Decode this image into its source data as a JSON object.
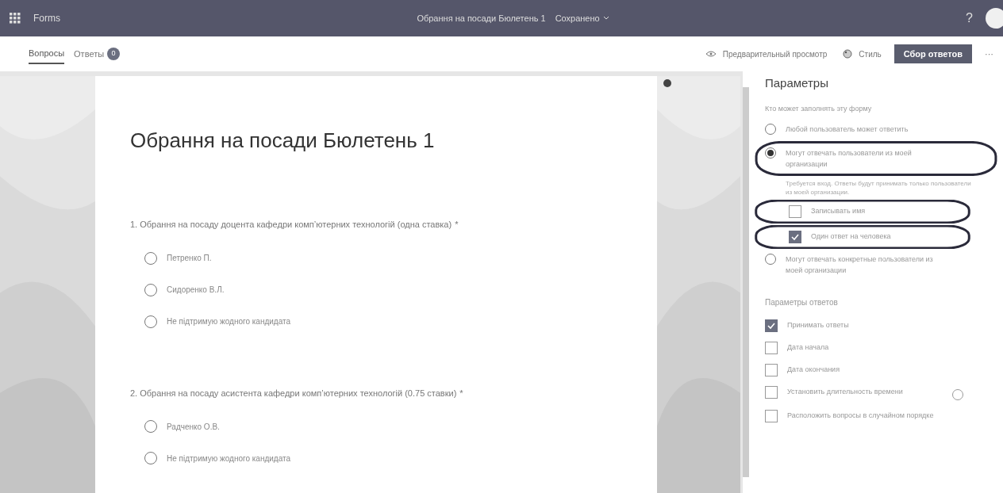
{
  "header": {
    "app": "Forms",
    "title": "Обрання на посади Бюлетень 1",
    "status": "Сохранено",
    "help": "?"
  },
  "tabs": [
    {
      "label": "Вопросы",
      "selected": true
    },
    {
      "label": "Ответы",
      "selected": false,
      "badge": "0"
    }
  ],
  "toolbar": {
    "preview": "Предварительный просмотр",
    "style": "Стиль",
    "collect": "Сбор ответов",
    "more": "···"
  },
  "form": {
    "title": "Обрання на посади Бюлетень 1",
    "questions": [
      {
        "text": "1. Обрання на посаду доцента кафедри комп’ютерних технологій (одна ставка)",
        "required_mark": "*",
        "options": [
          {
            "label": "Петренко П.",
            "selected": false
          },
          {
            "label": "Сидоренко В.Л.",
            "selected": false
          },
          {
            "label": "Не підтримую жодного кандидата",
            "selected": false
          }
        ]
      },
      {
        "text": "2. Обрання на посаду асистента кафедри комп’ютерних технологій (0.75 ставки)",
        "required_mark": "*",
        "options": [
          {
            "label": "Радченко О.В.",
            "selected": false
          },
          {
            "label": "Не підтримую жодного кандидата",
            "selected": false
          }
        ]
      }
    ]
  },
  "settings": {
    "title": "Параметры",
    "who_label": "Кто может заполнять эту форму",
    "who": [
      {
        "kind": "radio",
        "label": "Любой пользователь может ответить",
        "selected": false
      },
      {
        "kind": "radio",
        "label": "Могут отвечать пользователи из моей организации",
        "selected": true,
        "circled": true
      },
      {
        "kind": "note",
        "label": "Требуется вход. Ответы будут принимать только пользователи из моей организации."
      },
      {
        "kind": "checkbox",
        "label": "Записывать имя",
        "checked": false,
        "circled": true
      },
      {
        "kind": "checkbox",
        "label": "Один ответ на человека",
        "checked": true,
        "circled": true
      },
      {
        "kind": "radio",
        "label": "Могут отвечать конкретные пользователи из моей организации",
        "selected": false
      }
    ],
    "response_label": "Параметры ответов",
    "response": [
      {
        "label": "Принимать ответы",
        "checked": true
      },
      {
        "label": "Дата начала",
        "checked": false
      },
      {
        "label": "Дата окончания",
        "checked": false
      },
      {
        "label": "Установить длительность времени",
        "checked": false,
        "info": true
      },
      {
        "label": "Расположить вопросы в случайном порядке",
        "checked": false
      }
    ]
  }
}
